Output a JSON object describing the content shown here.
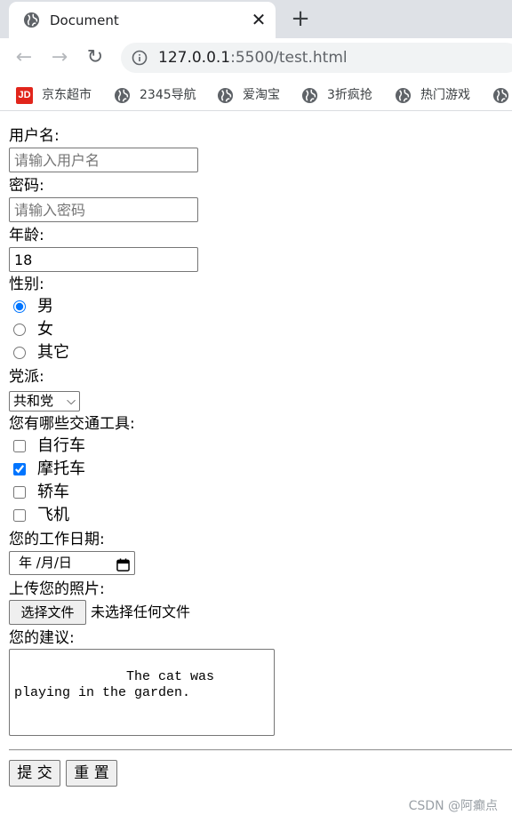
{
  "browser": {
    "tab_title": "Document",
    "url_host": "127.0.0.1",
    "url_path": ":5500/test.html",
    "bookmarks": [
      {
        "label": "京东超市",
        "icon": "jd-logo"
      },
      {
        "label": "2345导航",
        "icon": "globe-icon"
      },
      {
        "label": "爱淘宝",
        "icon": "globe-icon"
      },
      {
        "label": "3折疯抢",
        "icon": "globe-icon"
      },
      {
        "label": "热门游戏",
        "icon": "globe-icon"
      }
    ],
    "jd_logo_text": "JD"
  },
  "form": {
    "username_label": "用户名:",
    "username_placeholder": "请输入用户名",
    "password_label": "密码:",
    "password_placeholder": "请输入密码",
    "age_label": "年龄:",
    "age_value": "18",
    "gender_label": "性别:",
    "gender_options": [
      "男",
      "女",
      "其它"
    ],
    "gender_selected": "男",
    "party_label": "党派:",
    "party_selected": "共和党",
    "vehicles_label": "您有哪些交通工具:",
    "vehicle_options": [
      "自行车",
      "摩托车",
      "轿车",
      "飞机"
    ],
    "vehicle_checked": [
      "摩托车"
    ],
    "work_date_label": "您的工作日期:",
    "date_placeholder": "年 /月/日",
    "photo_label": "上传您的照片:",
    "file_button": "选择文件",
    "file_status": "未选择任何文件",
    "suggestion_label": "您的建议:",
    "suggestion_text": "          The cat was playing in the garden.",
    "submit_label": "提 交",
    "reset_label": "重 置"
  },
  "watermark": "CSDN @阿癫点"
}
